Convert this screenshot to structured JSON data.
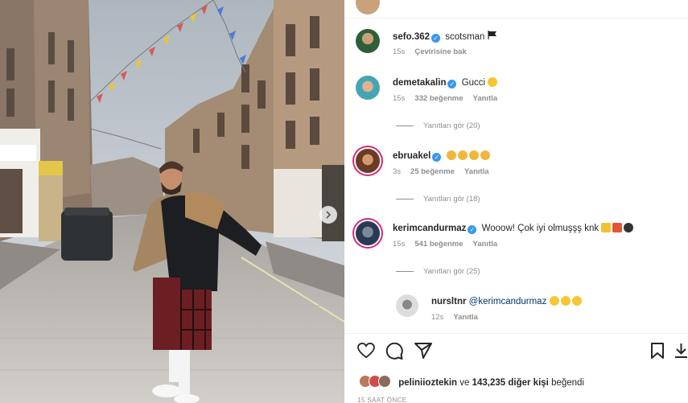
{
  "post": {
    "carousel_next_icon": "chevron-right-icon"
  },
  "comments": [
    {
      "username": "sefo.362",
      "verified": true,
      "text": "scotsman",
      "text_suffix_icon": "flag-icon",
      "age": "15s",
      "action": "Çevirisine bak",
      "likes": "",
      "reply_label": ""
    },
    {
      "username": "demetakalin",
      "verified": true,
      "text": "Gucci",
      "text_suffix_icon": "cool-emoji-icon",
      "age": "15s",
      "likes": "332 beğenme",
      "reply_label": "Yanıtla",
      "view_replies": "Yanıtları gör (20)"
    },
    {
      "username": "ebruakel",
      "verified": true,
      "text": "",
      "text_suffix_icon": "clap-emoji-icons",
      "age": "3s",
      "likes": "25 beğenme",
      "reply_label": "Yanıtla",
      "view_replies": "Yanıtları gör (18)"
    },
    {
      "username": "kerimcandurmaz",
      "verified": true,
      "text": "Wooow! Çok iyi olmuşşş knk",
      "text_suffix_icon": "lightning-boom-bomb-emoji-icons",
      "age": "15s",
      "likes": "541 beğenme",
      "reply_label": "Yanıtla",
      "view_replies": "Yanıtları gör (25)"
    }
  ],
  "reply": {
    "username": "nursltnr",
    "mention": "@kerimcandurmaz",
    "emoji_icon": "laughing-emoji-icons",
    "age": "12s",
    "reply_label": "Yanıtla"
  },
  "likes_line": {
    "first_user": "peliniioztekin",
    "connector": "ve",
    "others": "143,235 diğer kişi",
    "suffix": "beğendi"
  },
  "timestamp": "15 SAAT ÖNCE",
  "colors": {
    "verified": "#3897f0",
    "muted": "#8e8e8e",
    "text": "#262626",
    "story_ring": "#d62976"
  }
}
